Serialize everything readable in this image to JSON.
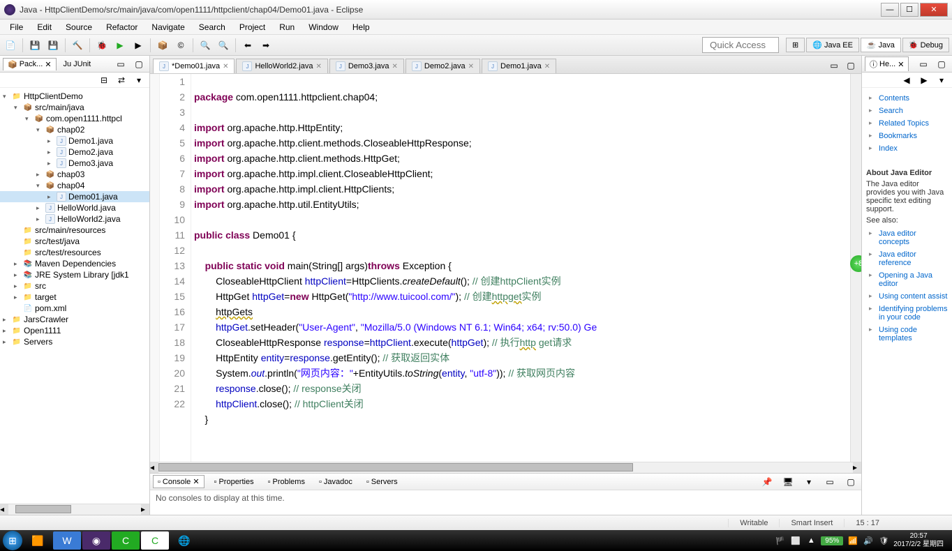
{
  "title": "Java - HttpClientDemo/src/main/java/com/open1111/httpclient/chap04/Demo01.java - Eclipse",
  "menus": [
    "File",
    "Edit",
    "Source",
    "Refactor",
    "Navigate",
    "Search",
    "Project",
    "Run",
    "Window",
    "Help"
  ],
  "quick_access": "Quick Access",
  "perspectives": [
    {
      "label": "Java EE",
      "icon": "🌐"
    },
    {
      "label": "Java",
      "icon": "☕"
    },
    {
      "label": "Debug",
      "icon": "🐞"
    }
  ],
  "package_explorer": {
    "tab": "Pack...",
    "junit_tab": "JUnit",
    "tree": [
      {
        "d": 0,
        "exp": "▾",
        "icon": "📁",
        "label": "HttpClientDemo",
        "cls": "folder-icon"
      },
      {
        "d": 1,
        "exp": "▾",
        "icon": "📦",
        "label": "src/main/java",
        "cls": "pkg-icon"
      },
      {
        "d": 2,
        "exp": "▾",
        "icon": "📦",
        "label": "com.open1111.httpcl",
        "cls": "pkg-icon"
      },
      {
        "d": 3,
        "exp": "▾",
        "icon": "📦",
        "label": "chap02",
        "cls": "pkg-icon"
      },
      {
        "d": 4,
        "exp": "▸",
        "icon": "J",
        "label": "Demo1.java",
        "cls": "java-icon"
      },
      {
        "d": 4,
        "exp": "▸",
        "icon": "J",
        "label": "Demo2.java",
        "cls": "java-icon"
      },
      {
        "d": 4,
        "exp": "▸",
        "icon": "J",
        "label": "Demo3.java",
        "cls": "java-icon"
      },
      {
        "d": 3,
        "exp": "▸",
        "icon": "📦",
        "label": "chap03",
        "cls": "pkg-icon"
      },
      {
        "d": 3,
        "exp": "▾",
        "icon": "📦",
        "label": "chap04",
        "cls": "pkg-icon"
      },
      {
        "d": 4,
        "exp": "▸",
        "icon": "J",
        "label": "Demo01.java",
        "cls": "java-icon",
        "sel": true
      },
      {
        "d": 3,
        "exp": "▸",
        "icon": "J",
        "label": "HelloWorld.java",
        "cls": "java-icon"
      },
      {
        "d": 3,
        "exp": "▸",
        "icon": "J",
        "label": "HelloWorld2.java",
        "cls": "java-icon"
      },
      {
        "d": 1,
        "exp": "",
        "icon": "📁",
        "label": "src/main/resources",
        "cls": "folder-icon"
      },
      {
        "d": 1,
        "exp": "",
        "icon": "📁",
        "label": "src/test/java",
        "cls": "folder-icon"
      },
      {
        "d": 1,
        "exp": "",
        "icon": "📁",
        "label": "src/test/resources",
        "cls": "folder-icon"
      },
      {
        "d": 1,
        "exp": "▸",
        "icon": "📚",
        "label": "Maven Dependencies",
        "cls": "folder-icon"
      },
      {
        "d": 1,
        "exp": "▸",
        "icon": "📚",
        "label": "JRE System Library [jdk1",
        "cls": "folder-icon"
      },
      {
        "d": 1,
        "exp": "▸",
        "icon": "📁",
        "label": "src",
        "cls": "folder-icon"
      },
      {
        "d": 1,
        "exp": "▸",
        "icon": "📁",
        "label": "target",
        "cls": "folder-icon"
      },
      {
        "d": 1,
        "exp": "",
        "icon": "📄",
        "label": "pom.xml",
        "cls": ""
      },
      {
        "d": 0,
        "exp": "▸",
        "icon": "📁",
        "label": "JarsCrawler",
        "cls": "folder-icon"
      },
      {
        "d": 0,
        "exp": "▸",
        "icon": "📁",
        "label": "Open1111",
        "cls": "folder-icon"
      },
      {
        "d": 0,
        "exp": "▸",
        "icon": "📁",
        "label": "Servers",
        "cls": "folder-icon"
      }
    ]
  },
  "editor": {
    "tabs": [
      {
        "label": "*Demo01.java",
        "active": true
      },
      {
        "label": "HelloWorld2.java"
      },
      {
        "label": "Demo3.java"
      },
      {
        "label": "Demo2.java"
      },
      {
        "label": "Demo1.java"
      }
    ],
    "lines": [
      1,
      2,
      3,
      4,
      5,
      6,
      7,
      8,
      9,
      10,
      11,
      12,
      13,
      14,
      15,
      16,
      17,
      18,
      19,
      20,
      21,
      22
    ]
  },
  "bottom": {
    "tabs": [
      {
        "label": "Console",
        "active": true
      },
      {
        "label": "Properties"
      },
      {
        "label": "Problems"
      },
      {
        "label": "Javadoc"
      },
      {
        "label": "Servers"
      }
    ],
    "msg": "No consoles to display at this time."
  },
  "help": {
    "tab": "He...",
    "top_links": [
      "Contents",
      "Search",
      "Related Topics",
      "Bookmarks",
      "Index"
    ],
    "heading": "About Java Editor",
    "text": "The Java editor provides you with Java specific text editing support.",
    "see_also": "See also:",
    "links": [
      "Java editor concepts",
      "Java editor reference",
      "Opening a Java editor",
      "Using content assist",
      "Identifying problems in your code",
      "Using code templates"
    ]
  },
  "status": {
    "writable": "Writable",
    "insert": "Smart Insert",
    "pos": "15 : 17"
  },
  "taskbar": {
    "battery": "95%",
    "time": "20:57",
    "date": "2017/2/2 星期四"
  },
  "code": {
    "l1_kw": "package",
    "l1_rest": " com.open1111.httpclient.chap04;",
    "l3_kw": "import",
    "l3_rest": " org.apache.http.HttpEntity;",
    "l4_kw": "import",
    "l4_rest": " org.apache.http.client.methods.CloseableHttpResponse;",
    "l5_kw": "import",
    "l5_rest": " org.apache.http.client.methods.HttpGet;",
    "l6_kw": "import",
    "l6_rest": " org.apache.http.impl.client.CloseableHttpClient;",
    "l7_kw": "import",
    "l7_rest": " org.apache.http.impl.client.HttpClients;",
    "l8_kw": "import",
    "l8_rest": " org.apache.http.util.EntityUtils;",
    "l10_a": "public class",
    "l10_b": " Demo01 {",
    "l12_a": "    ",
    "l12_b": "public static void",
    "l12_c": " main(String[] args)",
    "l12_d": "throws",
    "l12_e": " Exception {",
    "l13_a": "        CloseableHttpClient ",
    "l13_b": "httpClient",
    "l13_c": "=HttpClients.",
    "l13_d": "createDefault",
    "l13_e": "(); ",
    "l13_f": "// 创建httpClient实例",
    "l14_a": "        HttpGet ",
    "l14_b": "httpGet",
    "l14_c": "=",
    "l14_d": "new",
    "l14_e": " HttpGet(",
    "l14_f": "\"http://www.tuicool.com/\"",
    "l14_g": "); ",
    "l14_h": "// 创建",
    "l14_i": "httpget",
    "l14_j": "实例",
    "l15_a": "        ",
    "l15_b": "httpGets",
    "l16_a": "        ",
    "l16_b": "httpGet",
    "l16_c": ".setHeader(",
    "l16_d": "\"User-Agent\"",
    "l16_e": ", ",
    "l16_f": "\"Mozilla/5.0 (Windows NT 6.1; Win64; x64; rv:50.0) Ge",
    "l17_a": "        CloseableHttpResponse ",
    "l17_b": "response",
    "l17_c": "=",
    "l17_d": "httpClient",
    "l17_e": ".execute(",
    "l17_f": "httpGet",
    "l17_g": "); ",
    "l17_h": "// 执行",
    "l17_i": "http",
    "l17_j": " get请求",
    "l18_a": "        HttpEntity ",
    "l18_b": "entity",
    "l18_c": "=",
    "l18_d": "response",
    "l18_e": ".getEntity(); ",
    "l18_f": "// 获取返回实体",
    "l19_a": "        System.",
    "l19_b": "out",
    "l19_c": ".println(",
    "l19_d": "\"网页内容：\"",
    "l19_e": "+EntityUtils.",
    "l19_f": "toString",
    "l19_g": "(",
    "l19_h": "entity",
    "l19_i": ", ",
    "l19_j": "\"utf-8\"",
    "l19_k": ")); ",
    "l19_l": "// 获取网页内容",
    "l20_a": "        ",
    "l20_b": "response",
    "l20_c": ".close(); ",
    "l20_d": "// response关闭",
    "l21_a": "        ",
    "l21_b": "httpClient",
    "l21_c": ".close(); ",
    "l21_d": "// httpClient关闭",
    "l22": "    }"
  }
}
